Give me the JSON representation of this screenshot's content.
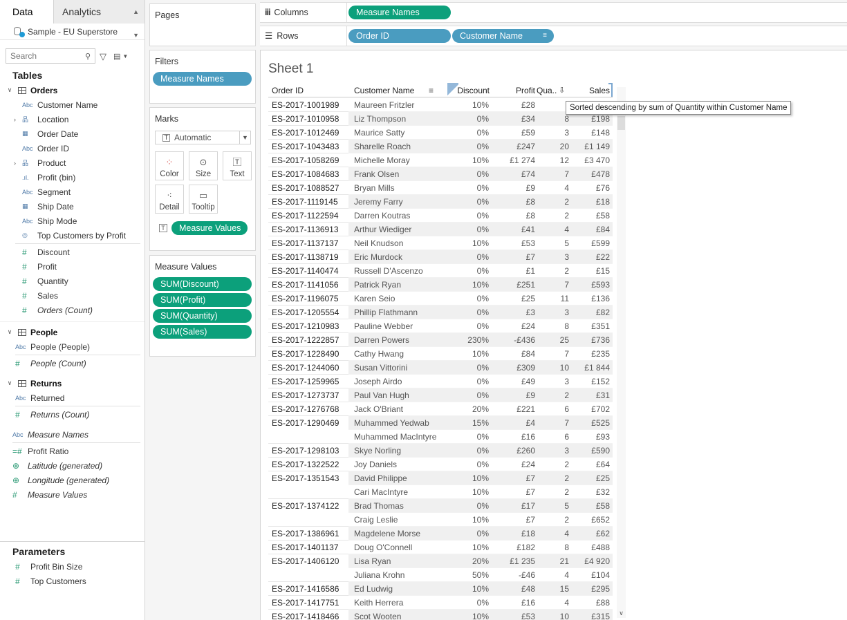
{
  "data_pane": {
    "tabs": [
      "Data",
      "Analytics"
    ],
    "datasource": "Sample - EU Superstore",
    "search_placeholder": "Search",
    "tables_title": "Tables",
    "orders": {
      "name": "Orders",
      "fields": [
        {
          "label": "Customer Name",
          "type": "Abc",
          "expand": false,
          "italic": false
        },
        {
          "label": "Location",
          "type": "hier",
          "expand": true,
          "italic": false
        },
        {
          "label": "Order Date",
          "type": "date",
          "expand": false,
          "italic": false
        },
        {
          "label": "Order ID",
          "type": "Abc",
          "expand": false,
          "italic": false
        },
        {
          "label": "Product",
          "type": "hier",
          "expand": true,
          "italic": false
        },
        {
          "label": "Profit (bin)",
          "type": "bin",
          "expand": false,
          "italic": false
        },
        {
          "label": "Segment",
          "type": "Abc",
          "expand": false,
          "italic": false
        },
        {
          "label": "Ship Date",
          "type": "date",
          "expand": false,
          "italic": false
        },
        {
          "label": "Ship Mode",
          "type": "Abc",
          "expand": false,
          "italic": false
        },
        {
          "label": "Top Customers by Profit",
          "type": "set",
          "expand": false,
          "italic": false
        }
      ],
      "measures": [
        {
          "label": "Discount",
          "italic": false
        },
        {
          "label": "Profit",
          "italic": false
        },
        {
          "label": "Quantity",
          "italic": false
        },
        {
          "label": "Sales",
          "italic": false
        },
        {
          "label": "Orders (Count)",
          "italic": true
        }
      ]
    },
    "people": {
      "name": "People",
      "dim": "People (People)",
      "measure": "People (Count)"
    },
    "returns": {
      "name": "Returns",
      "dim": "Returned",
      "measure": "Returns (Count)"
    },
    "extra": [
      {
        "label": "Measure Names",
        "type": "Abc",
        "italic": true
      },
      {
        "label": "Profit Ratio",
        "type": "calc",
        "italic": false
      },
      {
        "label": "Latitude (generated)",
        "type": "geo",
        "italic": true
      },
      {
        "label": "Longitude (generated)",
        "type": "geo",
        "italic": true
      },
      {
        "label": "Measure Values",
        "type": "meas",
        "italic": true
      }
    ],
    "parameters_title": "Parameters",
    "parameters": [
      "Profit Bin Size",
      "Top Customers"
    ]
  },
  "cards": {
    "pages": "Pages",
    "filters": "Filters",
    "filter_pill": "Measure Names",
    "marks": "Marks",
    "mark_type": "Automatic",
    "mark_buttons": [
      "Color",
      "Size",
      "Text",
      "Detail",
      "Tooltip"
    ],
    "marks_pill": "Measure Values",
    "measure_values_title": "Measure Values",
    "measure_values": [
      "SUM(Discount)",
      "SUM(Profit)",
      "SUM(Quantity)",
      "SUM(Sales)"
    ]
  },
  "shelves": {
    "columns_label": "Columns",
    "rows_label": "Rows",
    "columns_pill": "Measure Names",
    "rows_pills": [
      "Order ID",
      "Customer Name"
    ]
  },
  "sheet": {
    "title": "Sheet 1",
    "headers": {
      "order": "Order ID",
      "customer": "Customer Name",
      "discount": "Discount",
      "profit": "Profit",
      "quantity": "Qua..",
      "sales": "Sales"
    },
    "tooltip": "Sorted descending by sum of Quantity within Customer Name",
    "rows": [
      {
        "order": "ES-2017-1001989",
        "customer": "Maureen Fritzler",
        "discount": "10%",
        "profit": "£28",
        "quantity": "",
        "sales": ""
      },
      {
        "order": "ES-2017-1010958",
        "customer": "Liz Thompson",
        "discount": "0%",
        "profit": "£34",
        "quantity": "8",
        "sales": "£198"
      },
      {
        "order": "ES-2017-1012469",
        "customer": "Maurice Satty",
        "discount": "0%",
        "profit": "£59",
        "quantity": "3",
        "sales": "£148"
      },
      {
        "order": "ES-2017-1043483",
        "customer": "Sharelle Roach",
        "discount": "0%",
        "profit": "£247",
        "quantity": "20",
        "sales": "£1 149"
      },
      {
        "order": "ES-2017-1058269",
        "customer": "Michelle Moray",
        "discount": "10%",
        "profit": "£1 274",
        "quantity": "12",
        "sales": "£3 470"
      },
      {
        "order": "ES-2017-1084683",
        "customer": "Frank Olsen",
        "discount": "0%",
        "profit": "£74",
        "quantity": "7",
        "sales": "£478"
      },
      {
        "order": "ES-2017-1088527",
        "customer": "Bryan Mills",
        "discount": "0%",
        "profit": "£9",
        "quantity": "4",
        "sales": "£76"
      },
      {
        "order": "ES-2017-1119145",
        "customer": "Jeremy Farry",
        "discount": "0%",
        "profit": "£8",
        "quantity": "2",
        "sales": "£18"
      },
      {
        "order": "ES-2017-1122594",
        "customer": "Darren Koutras",
        "discount": "0%",
        "profit": "£8",
        "quantity": "2",
        "sales": "£58"
      },
      {
        "order": "ES-2017-1136913",
        "customer": "Arthur Wiediger",
        "discount": "0%",
        "profit": "£41",
        "quantity": "4",
        "sales": "£84"
      },
      {
        "order": "ES-2017-1137137",
        "customer": "Neil Knudson",
        "discount": "10%",
        "profit": "£53",
        "quantity": "5",
        "sales": "£599"
      },
      {
        "order": "ES-2017-1138719",
        "customer": "Eric Murdock",
        "discount": "0%",
        "profit": "£7",
        "quantity": "3",
        "sales": "£22"
      },
      {
        "order": "ES-2017-1140474",
        "customer": "Russell D'Ascenzo",
        "discount": "0%",
        "profit": "£1",
        "quantity": "2",
        "sales": "£15"
      },
      {
        "order": "ES-2017-1141056",
        "customer": "Patrick Ryan",
        "discount": "10%",
        "profit": "£251",
        "quantity": "7",
        "sales": "£593"
      },
      {
        "order": "ES-2017-1196075",
        "customer": "Karen Seio",
        "discount": "0%",
        "profit": "£25",
        "quantity": "11",
        "sales": "£136"
      },
      {
        "order": "ES-2017-1205554",
        "customer": "Phillip Flathmann",
        "discount": "0%",
        "profit": "£3",
        "quantity": "3",
        "sales": "£82"
      },
      {
        "order": "ES-2017-1210983",
        "customer": "Pauline Webber",
        "discount": "0%",
        "profit": "£24",
        "quantity": "8",
        "sales": "£351"
      },
      {
        "order": "ES-2017-1222857",
        "customer": "Darren Powers",
        "discount": "230%",
        "profit": "-£436",
        "quantity": "25",
        "sales": "£736"
      },
      {
        "order": "ES-2017-1228490",
        "customer": "Cathy Hwang",
        "discount": "10%",
        "profit": "£84",
        "quantity": "7",
        "sales": "£235"
      },
      {
        "order": "ES-2017-1244060",
        "customer": "Susan Vittorini",
        "discount": "0%",
        "profit": "£309",
        "quantity": "10",
        "sales": "£1 844"
      },
      {
        "order": "ES-2017-1259965",
        "customer": "Joseph Airdo",
        "discount": "0%",
        "profit": "£49",
        "quantity": "3",
        "sales": "£152"
      },
      {
        "order": "ES-2017-1273737",
        "customer": "Paul Van Hugh",
        "discount": "0%",
        "profit": "£9",
        "quantity": "2",
        "sales": "£31"
      },
      {
        "order": "ES-2017-1276768",
        "customer": "Jack O'Briant",
        "discount": "20%",
        "profit": "£221",
        "quantity": "6",
        "sales": "£702"
      },
      {
        "order": "ES-2017-1290469",
        "customer": "Muhammed Yedwab",
        "discount": "15%",
        "profit": "£4",
        "quantity": "7",
        "sales": "£525"
      },
      {
        "order": "",
        "customer": "Muhammed MacIntyre",
        "discount": "0%",
        "profit": "£16",
        "quantity": "6",
        "sales": "£93"
      },
      {
        "order": "ES-2017-1298103",
        "customer": "Skye Norling",
        "discount": "0%",
        "profit": "£260",
        "quantity": "3",
        "sales": "£590"
      },
      {
        "order": "ES-2017-1322522",
        "customer": "Joy Daniels",
        "discount": "0%",
        "profit": "£24",
        "quantity": "2",
        "sales": "£64"
      },
      {
        "order": "ES-2017-1351543",
        "customer": "David Philippe",
        "discount": "10%",
        "profit": "£7",
        "quantity": "2",
        "sales": "£25"
      },
      {
        "order": "",
        "customer": "Cari MacIntyre",
        "discount": "10%",
        "profit": "£7",
        "quantity": "2",
        "sales": "£32"
      },
      {
        "order": "ES-2017-1374122",
        "customer": "Brad Thomas",
        "discount": "0%",
        "profit": "£17",
        "quantity": "5",
        "sales": "£58"
      },
      {
        "order": "",
        "customer": "Craig Leslie",
        "discount": "10%",
        "profit": "£7",
        "quantity": "2",
        "sales": "£652"
      },
      {
        "order": "ES-2017-1386961",
        "customer": "Magdelene Morse",
        "discount": "0%",
        "profit": "£18",
        "quantity": "4",
        "sales": "£62"
      },
      {
        "order": "ES-2017-1401137",
        "customer": "Doug O'Connell",
        "discount": "10%",
        "profit": "£182",
        "quantity": "8",
        "sales": "£488"
      },
      {
        "order": "ES-2017-1406120",
        "customer": "Lisa Ryan",
        "discount": "20%",
        "profit": "£1 235",
        "quantity": "21",
        "sales": "£4 920"
      },
      {
        "order": "",
        "customer": "Juliana Krohn",
        "discount": "50%",
        "profit": "-£46",
        "quantity": "4",
        "sales": "£104"
      },
      {
        "order": "ES-2017-1416586",
        "customer": "Ed Ludwig",
        "discount": "10%",
        "profit": "£48",
        "quantity": "15",
        "sales": "£295"
      },
      {
        "order": "ES-2017-1417751",
        "customer": "Keith Herrera",
        "discount": "0%",
        "profit": "£16",
        "quantity": "4",
        "sales": "£88"
      },
      {
        "order": "ES-2017-1418466",
        "customer": "Scot Wooten",
        "discount": "10%",
        "profit": "£53",
        "quantity": "10",
        "sales": "£315"
      }
    ]
  },
  "colors": {
    "dimension_pill": "#4a9cc0",
    "measure_pill": "#0ca07b"
  }
}
